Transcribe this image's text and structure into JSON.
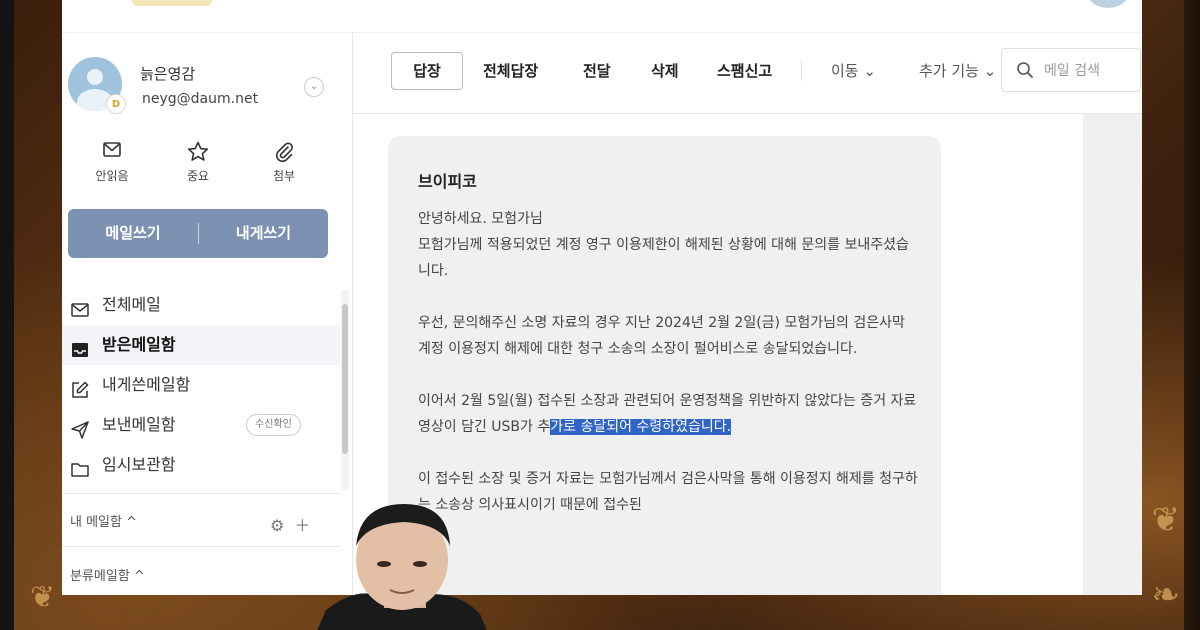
{
  "account": {
    "name": "늙은영감",
    "email": "neyg@daum.net",
    "badge": "D"
  },
  "quick_filters": [
    {
      "label": "안읽음",
      "icon": "mail-icon"
    },
    {
      "label": "중요",
      "icon": "star-icon"
    },
    {
      "label": "첨부",
      "icon": "paperclip-icon"
    }
  ],
  "compose": {
    "write_label": "메일쓰기",
    "self_label": "내게쓰기"
  },
  "folders": [
    {
      "label": "전체메일",
      "icon": "mail-icon"
    },
    {
      "label": "받은메일함",
      "icon": "inbox-icon",
      "active": true
    },
    {
      "label": "내게쓴메일함",
      "icon": "edit-icon"
    },
    {
      "label": "보낸메일함",
      "icon": "send-icon",
      "pill": "수신확인"
    },
    {
      "label": "임시보관함",
      "icon": "folder-icon"
    }
  ],
  "sections": {
    "my_mailbox": "내 메일함 ^",
    "categories": "분류메일함 ^"
  },
  "toolbar": {
    "reply": "답장",
    "reply_all": "전체답장",
    "forward": "전달",
    "delete": "삭제",
    "spam": "스팸신고",
    "move": "이동 ⌄",
    "more": "추가 기능 ⌄",
    "search_placeholder": "메일 검색"
  },
  "message": {
    "sender": "브이피코",
    "greeting": "안녕하세요. 모험가님",
    "line1": "모험가님께 적용되었던 계정 영구 이용제한이 해제된 상황에 대해 문의를 보내주셨습니다.",
    "para2": "우선, 문의해주신 소명 자료의 경우 지난 2024년 2월 2일(금) 모험가님의 검은사막 계정 이용정지 해제에 대한 청구 소송의 소장이 펄어비스로 송달되었습니다.",
    "para3_before": "이어서 2월 5일(월) 접수된 소장과 관련되어 운영정책을 위반하지 않았다는 증거 자료 영상이 담긴 USB가 추",
    "para3_selected": "가로 송달되어 수령하였습니다.",
    "para4": "이 접수된 소장 및 증거 자료는 모험가님께서 검은사막을 통해 이용정지 해제를 청구하는 소송상 의사표시이기 때문에 접수된"
  }
}
